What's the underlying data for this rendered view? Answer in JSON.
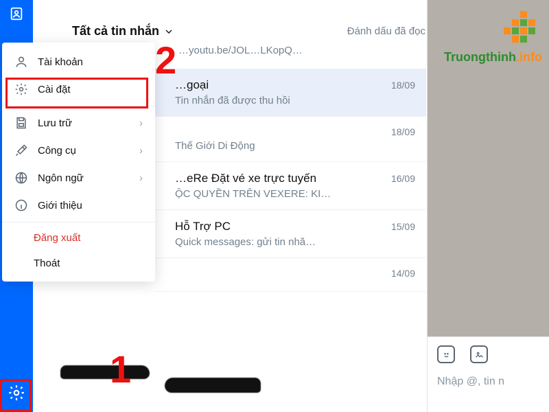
{
  "sidebar": {
    "top_icon": "contact-icon",
    "gear_icon": "gear-icon"
  },
  "header": {
    "title": "Tất cả tin nhắn",
    "mark_read": "Đánh dấu đã đọc",
    "truncated_below": "…youtu.be/JOL…LKopQ…"
  },
  "menu": {
    "items": [
      {
        "icon": "user",
        "label": "Tài khoản",
        "has_sub": false
      },
      {
        "icon": "gear",
        "label": "Cài đặt",
        "has_sub": false
      },
      {
        "icon": "save",
        "label": "Lưu trữ",
        "has_sub": true
      },
      {
        "icon": "tools",
        "label": "Công cụ",
        "has_sub": true
      },
      {
        "icon": "globe",
        "label": "Ngôn ngữ",
        "has_sub": true
      },
      {
        "icon": "info",
        "label": "Giới thiệu",
        "has_sub": false
      }
    ],
    "logout": "Đăng xuất",
    "quit": "Thoát"
  },
  "annotations": {
    "step1": "1",
    "step2": "2"
  },
  "messages": [
    {
      "title": "…goại",
      "date": "18/09",
      "sub": "Tin nhắn đã được thu hồi",
      "selected": true
    },
    {
      "title": "",
      "date": "18/09",
      "sub": "Thế Giới Di Động",
      "selected": false
    },
    {
      "title": "…eRe Đặt vé xe trực tuyến",
      "date": "16/09",
      "sub": "ỘC QUYỀN TRÊN VEXERE: KI…",
      "selected": false
    },
    {
      "title": "Hỗ Trợ PC",
      "date": "15/09",
      "sub": "Quick messages: gửi tin nhă…",
      "selected": false
    },
    {
      "title": "",
      "date": "14/09",
      "sub": "",
      "selected": false
    }
  ],
  "right": {
    "logo_green": "Truongthinh",
    "logo_orange": ".info",
    "compose_placeholder": "Nhập @, tin n"
  }
}
